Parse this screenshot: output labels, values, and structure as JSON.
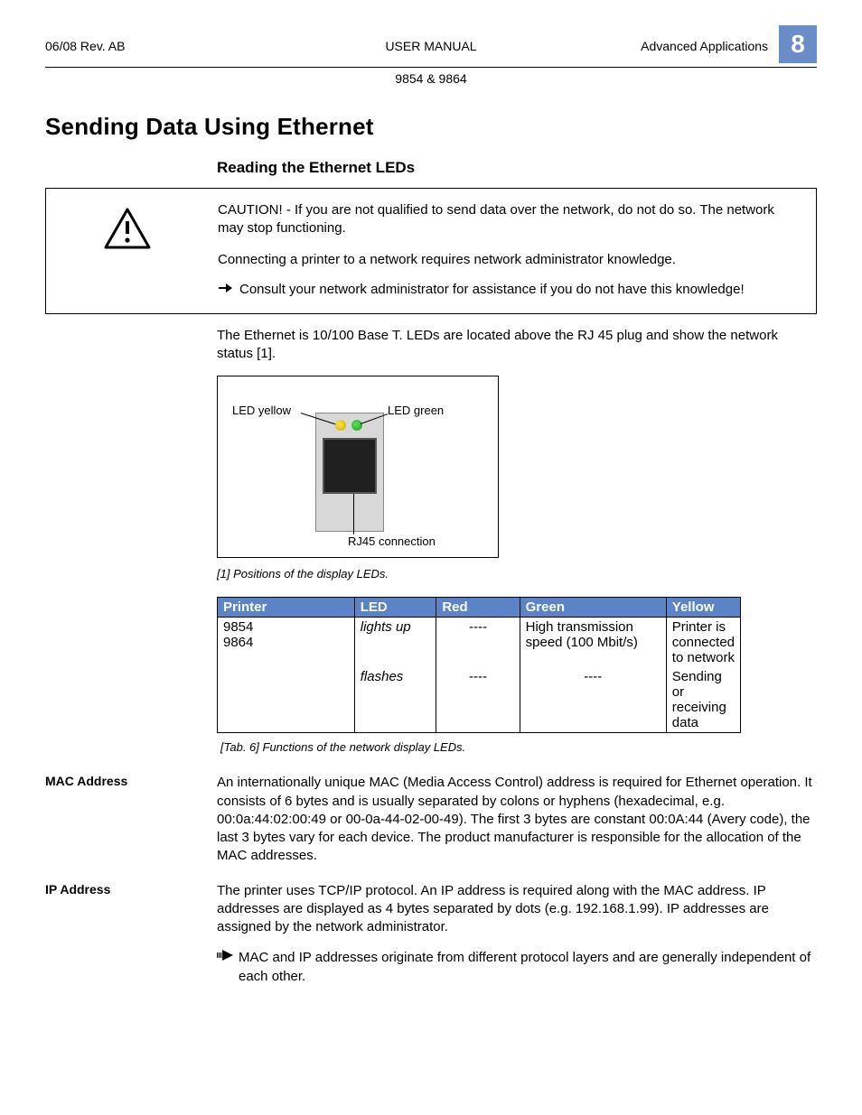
{
  "header": {
    "left": "06/08 Rev. AB",
    "center": "USER MANUAL",
    "right": "Advanced Applications",
    "chapter": "8",
    "sub": "9854 & 9864"
  },
  "section_title": "Sending Data Using Ethernet",
  "subsection_title": "Reading the Ethernet LEDs",
  "caution": {
    "p1": "CAUTION! - If you are not qualified to send data over the network, do not do so.  The network may stop functioning.",
    "p2": "Connecting a printer to a network requires network administrator knowledge.",
    "p3": "Consult your network administrator for assistance if you do not have this knowledge!"
  },
  "ethernet_intro": "The Ethernet is 10/100 Base T.  LEDs are located above the RJ 45 plug and show the network status [1].",
  "figure": {
    "label_yellow": "LED yellow",
    "label_green": "LED green",
    "label_rj45": "RJ45 connection",
    "caption": "[1]   Positions of the display LEDs."
  },
  "table": {
    "headers": {
      "printer": "Printer",
      "led": "LED",
      "red": "Red",
      "green": "Green",
      "yellow": "Yellow"
    },
    "rows": [
      {
        "printer": "9854\n9864",
        "led": "lights up",
        "red": "----",
        "green": "High transmission speed (100 Mbit/s)",
        "yellow": "Printer is connected to network"
      },
      {
        "printer": "",
        "led": "flashes",
        "red": "----",
        "green": "----",
        "yellow": "Sending or receiving data"
      }
    ],
    "caption": "[Tab. 6]      Functions of the network display LEDs."
  },
  "mac": {
    "label": "MAC Address",
    "text": "An internationally unique MAC (Media Access Control) address is required for Ethernet operation. It consists of 6 bytes and is usually separated by colons or hyphens (hexadecimal, e.g. 00:0a:44:02:00:49 or 00-0a-44-02-00-49). The first 3 bytes are constant 00:0A:44 (Avery code), the last 3 bytes vary for each device. The product manufacturer is responsible for the allocation of the MAC addresses."
  },
  "ip": {
    "label": "IP Address",
    "text": "The printer uses  TCP/IP protocol.  An IP address is required along with the MAC address. IP addresses are displayed as 4 bytes separated by dots (e.g. 192.168.1.99). IP addresses are assigned by the network administrator.",
    "note": "MAC and IP addresses originate from different protocol layers and are generally independent of each other."
  }
}
